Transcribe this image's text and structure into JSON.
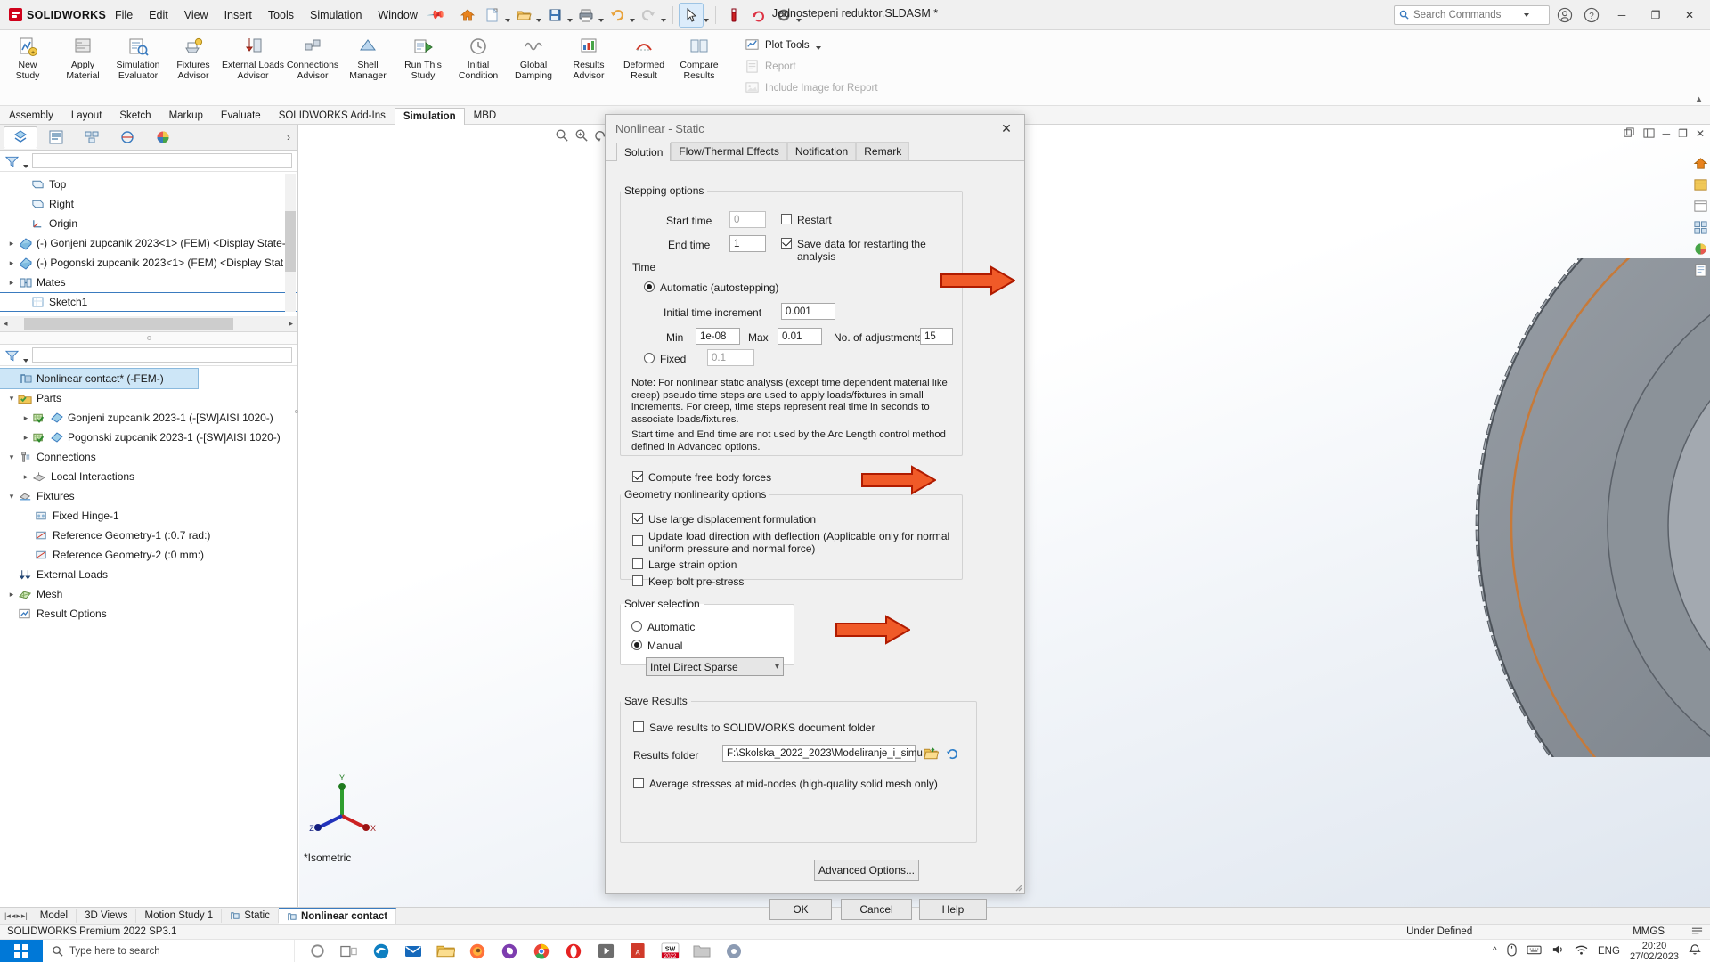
{
  "titlebar": {
    "brand": "SOLIDWORKS",
    "document_title": "Jednostepeni reduktor.SLDASM *",
    "menus": [
      "File",
      "Edit",
      "View",
      "Insert",
      "Tools",
      "Simulation",
      "Window"
    ],
    "pin_icon": "pin-icon",
    "search_placeholder": "Search Commands",
    "window_buttons": {
      "minimize": "─",
      "maximize": "❐",
      "close": "✕"
    }
  },
  "ribbon": {
    "items": [
      {
        "label": "New\nStudy",
        "icon": "new-study-icon"
      },
      {
        "label": "Apply\nMaterial",
        "icon": "apply-material-icon"
      },
      {
        "label": "Simulation\nEvaluator",
        "icon": "simulation-evaluator-icon"
      },
      {
        "label": "Fixtures\nAdvisor",
        "icon": "fixtures-advisor-icon"
      },
      {
        "label": "External Loads\nAdvisor",
        "icon": "external-loads-advisor-icon"
      },
      {
        "label": "Connections\nAdvisor",
        "icon": "connections-advisor-icon"
      },
      {
        "label": "Shell\nManager",
        "icon": "shell-manager-icon"
      },
      {
        "label": "Run This\nStudy",
        "icon": "run-this-study-icon"
      },
      {
        "label": "Initial\nCondition",
        "icon": "initial-condition-icon"
      },
      {
        "label": "Global\nDamping",
        "icon": "global-damping-icon"
      },
      {
        "label": "Results\nAdvisor",
        "icon": "results-advisor-icon"
      },
      {
        "label": "Deformed\nResult",
        "icon": "deformed-result-icon"
      },
      {
        "label": "Compare\nResults",
        "icon": "compare-results-icon"
      }
    ],
    "right_rows": [
      {
        "label": "Plot Tools",
        "icon": "plot-tools-icon",
        "dim": false,
        "dropdown": true
      },
      {
        "label": "Report",
        "icon": "report-icon",
        "dim": true,
        "dropdown": false
      },
      {
        "label": "Include Image for Report",
        "icon": "include-image-icon",
        "dim": true,
        "dropdown": false
      }
    ]
  },
  "command_tabs": [
    {
      "label": "Assembly",
      "active": false
    },
    {
      "label": "Layout",
      "active": false
    },
    {
      "label": "Sketch",
      "active": false
    },
    {
      "label": "Markup",
      "active": false
    },
    {
      "label": "Evaluate",
      "active": false
    },
    {
      "label": "SOLIDWORKS Add-Ins",
      "active": false
    },
    {
      "label": "Simulation",
      "active": true
    },
    {
      "label": "MBD",
      "active": false
    }
  ],
  "left_panel": {
    "tabs": [
      {
        "name": "feature-manager-tab",
        "icon": "feature-tree-icon",
        "selected": true
      },
      {
        "name": "property-manager-tab",
        "icon": "property-manager-icon",
        "selected": false
      },
      {
        "name": "configuration-manager-tab",
        "icon": "configuration-icon",
        "selected": false
      },
      {
        "name": "dimxpert-manager-tab",
        "icon": "dimxpert-icon",
        "selected": false
      },
      {
        "name": "display-manager-tab",
        "icon": "display-manager-icon",
        "selected": false
      }
    ],
    "expand_icon": "chevron-right-icon",
    "model_tree": [
      {
        "label": "Top",
        "icon": "plane-icon",
        "indent": 1,
        "twisty": ""
      },
      {
        "label": "Right",
        "icon": "plane-icon",
        "indent": 1,
        "twisty": ""
      },
      {
        "label": "Origin",
        "icon": "origin-icon",
        "indent": 1,
        "twisty": ""
      },
      {
        "label": "(-) Gonjeni zupcanik 2023<1> (FEM) <Display State-",
        "icon": "part-icon",
        "indent": 0,
        "twisty": "▸"
      },
      {
        "label": "(-) Pogonski zupcanik 2023<1> (FEM) <Display Stat",
        "icon": "part-icon",
        "indent": 0,
        "twisty": "▸"
      },
      {
        "label": "Mates",
        "icon": "mates-icon",
        "indent": 0,
        "twisty": "▸"
      },
      {
        "label": "Sketch1",
        "icon": "sketch-icon",
        "indent": 1,
        "twisty": ""
      }
    ],
    "study_tree": [
      {
        "label": "Nonlinear contact* (-FEM-)",
        "icon": "study-icon",
        "indent": 0,
        "twisty": "",
        "selected": true
      },
      {
        "label": "Parts",
        "icon": "parts-folder-icon",
        "indent": 1,
        "twisty": "▾"
      },
      {
        "label": "Gonjeni zupcanik 2023-1 (-[SW]AISI 1020-)",
        "icon": "solid-body-icon",
        "indent": 2,
        "twisty": "▸"
      },
      {
        "label": "Pogonski zupcanik 2023-1 (-[SW]AISI 1020-)",
        "icon": "solid-body-icon",
        "indent": 2,
        "twisty": "▸"
      },
      {
        "label": "Connections",
        "icon": "connections-icon",
        "indent": 1,
        "twisty": "▾"
      },
      {
        "label": "Local Interactions",
        "icon": "local-interactions-icon",
        "indent": 2,
        "twisty": "▸"
      },
      {
        "label": "Fixtures",
        "icon": "fixtures-icon",
        "indent": 1,
        "twisty": "▾"
      },
      {
        "label": "Fixed Hinge-1",
        "icon": "fixed-hinge-icon",
        "indent": 2,
        "twisty": ""
      },
      {
        "label": "Reference Geometry-1 (:0.7 rad:)",
        "icon": "reference-geometry-icon",
        "indent": 2,
        "twisty": ""
      },
      {
        "label": "Reference Geometry-2 (:0 mm:)",
        "icon": "reference-geometry-icon",
        "indent": 2,
        "twisty": ""
      },
      {
        "label": "External Loads",
        "icon": "external-loads-icon",
        "indent": 1,
        "twisty": ""
      },
      {
        "label": "Mesh",
        "icon": "mesh-icon",
        "indent": 1,
        "twisty": "▸"
      },
      {
        "label": "Result Options",
        "icon": "result-options-icon",
        "indent": 1,
        "twisty": ""
      }
    ]
  },
  "graphics": {
    "view_label": "*Isometric",
    "triad_axes": [
      "X",
      "Y",
      "Z"
    ],
    "window_buttons": {
      "restore_small": "❐",
      "minimize": "─",
      "maximize": "❐",
      "close": "✕"
    }
  },
  "bottom_tabs": {
    "nav_icons": [
      "|◂",
      "◂",
      "▸",
      "▸|"
    ],
    "tabs": [
      {
        "label": "Model",
        "active": false,
        "icon": ""
      },
      {
        "label": "3D Views",
        "active": false,
        "icon": ""
      },
      {
        "label": "Motion Study 1",
        "active": false,
        "icon": ""
      },
      {
        "label": "Static",
        "active": false,
        "icon": "study-tab-icon"
      },
      {
        "label": "Nonlinear contact",
        "active": true,
        "icon": "study-tab-icon"
      }
    ]
  },
  "statusbar": {
    "left": "SOLIDWORKS Premium 2022 SP3.1",
    "center": "Under Defined",
    "units": "MMGS",
    "right_icon": "customize-icon"
  },
  "taskbar": {
    "search_placeholder": "Type here to search",
    "start_icon": "windows-start-icon",
    "apps": [
      "cortana-icon",
      "task-view-icon",
      "edge-icon",
      "mail-icon",
      "explorer-icon",
      "firefox-icon",
      "viber-icon",
      "chrome-icon",
      "opera-icon",
      "media-player-icon",
      "pdf-icon",
      "solidworks-2022-icon",
      "folder-icon",
      "app-icon"
    ],
    "tray": [
      "show-hidden-icons",
      "mouse-icon",
      "keyboard-icon",
      "volume-icon",
      "network-icon"
    ],
    "language": "ENG",
    "time": "20:20",
    "date": "27/02/2023"
  },
  "dialog": {
    "title": "Nonlinear - Static",
    "close_icon": "close-icon",
    "tabs": [
      {
        "label": "Solution",
        "active": true
      },
      {
        "label": "Flow/Thermal Effects",
        "active": false
      },
      {
        "label": "Notification",
        "active": false
      },
      {
        "label": "Remark",
        "active": false
      }
    ],
    "stepping": {
      "legend": "Stepping options",
      "start_time_label": "Start time",
      "start_time_value": "0",
      "end_time_label": "End time",
      "end_time_value": "1",
      "restart_label": "Restart",
      "restart_checked": false,
      "save_restart_label": "Save data for restarting the analysis",
      "save_restart_checked": true,
      "time_label": "Time",
      "automatic_label": "Automatic (autostepping)",
      "automatic_selected": true,
      "initial_increment_label": "Initial time increment",
      "initial_increment_value": "0.001",
      "min_label": "Min",
      "min_value": "1e-08",
      "max_label": "Max",
      "max_value": "0.01",
      "adjustments_label": "No. of adjustments",
      "adjustments_value": "15",
      "fixed_label": "Fixed",
      "fixed_selected": false,
      "fixed_value": "0.1",
      "note_1": "Note: For nonlinear static analysis (except time dependent material like creep) pseudo time steps are used to apply loads/fixtures in small increments. For creep, time steps represent real time in seconds to associate loads/fixtures.",
      "note_2": "Start time and End time  are not used by the Arc Length control method defined in Advanced options."
    },
    "compute_free_body_label": "Compute free body forces",
    "compute_free_body_checked": true,
    "geometry": {
      "legend": "Geometry nonlinearity options",
      "options": [
        {
          "label": "Use large displacement formulation",
          "checked": true
        },
        {
          "label": "Update load direction with deflection (Applicable only for normal uniform pressure and normal force)",
          "checked": false
        },
        {
          "label": "Large strain option",
          "checked": false
        },
        {
          "label": "Keep bolt pre-stress",
          "checked": false
        }
      ]
    },
    "solver": {
      "legend": "Solver selection",
      "automatic_label": "Automatic",
      "manual_label": "Manual",
      "manual_selected": true,
      "selected_solver": "Intel Direct Sparse",
      "chevron_icon": "chevron-down-icon"
    },
    "save_results": {
      "legend": "Save Results",
      "save_to_doc_label": "Save results to SOLIDWORKS document folder",
      "save_to_doc_checked": false,
      "results_folder_label": "Results folder",
      "results_folder_value": "F:\\Skolska_2022_2023\\Modeliranje_i_simu",
      "browse_icon": "folder-browse-icon",
      "refresh_icon": "refresh-icon",
      "average_stresses_label": "Average stresses at mid-nodes (high-quality solid mesh only)",
      "average_stresses_checked": false
    },
    "advanced_button": "Advanced Options...",
    "buttons": {
      "ok": "OK",
      "cancel": "Cancel",
      "help": "Help"
    }
  },
  "annotations": {
    "arrow_color": "#e8420f",
    "arrows": [
      {
        "name": "arrow-initial-time-increment"
      },
      {
        "name": "arrow-large-displacement"
      },
      {
        "name": "arrow-solver-selection"
      }
    ]
  }
}
